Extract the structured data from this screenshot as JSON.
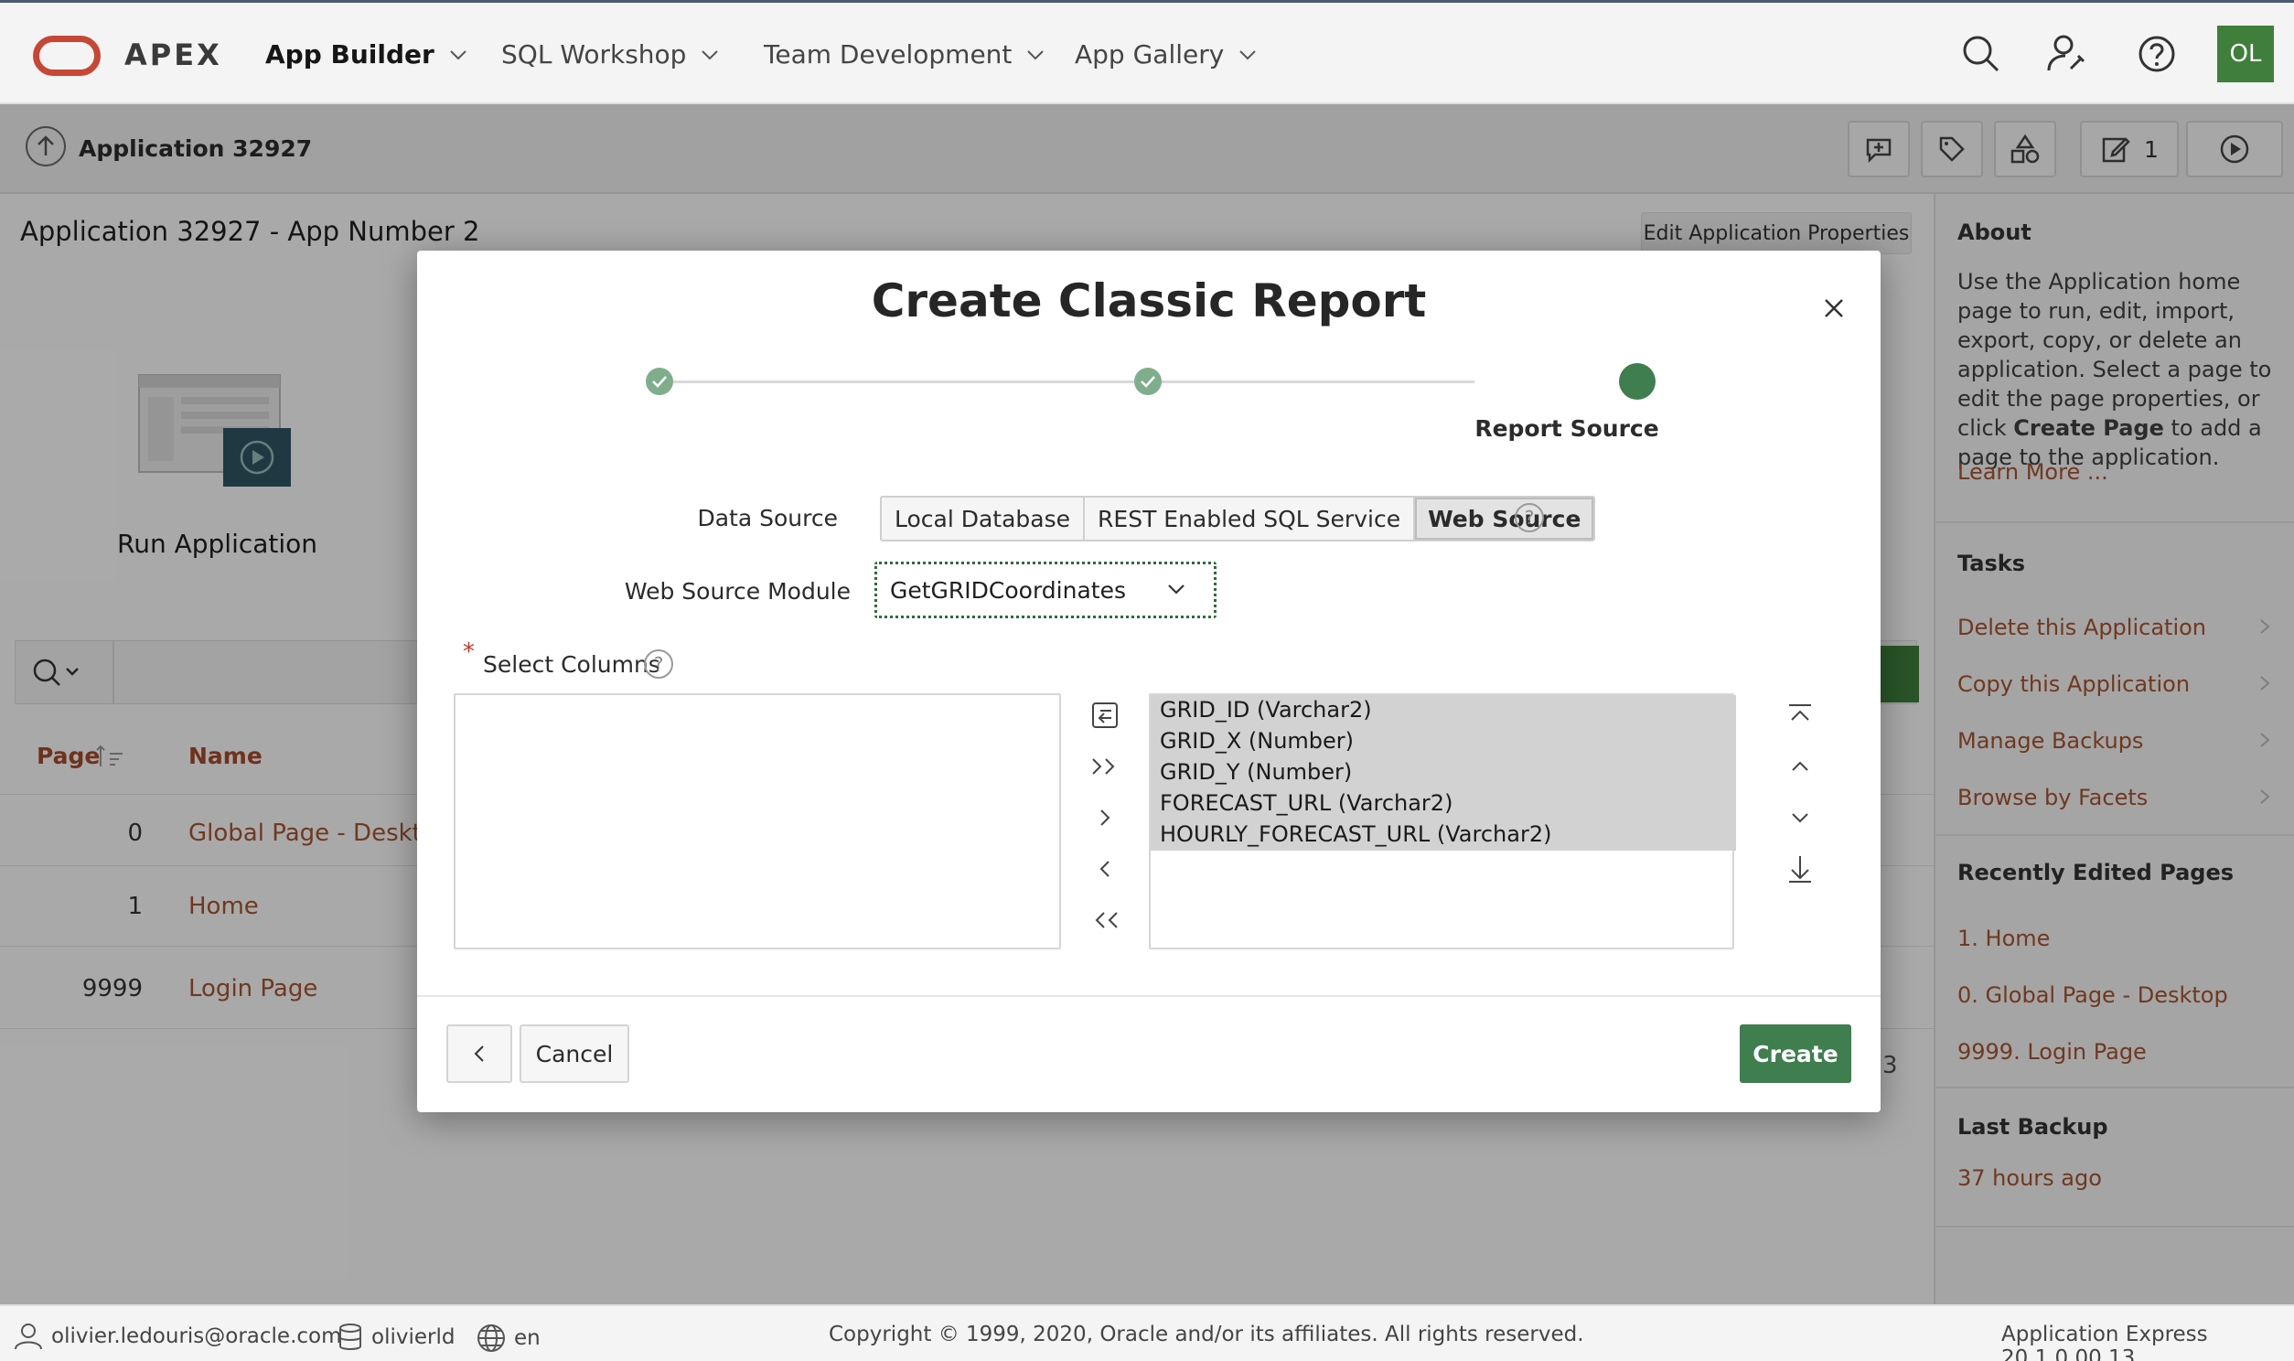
{
  "topnav": {
    "brand": "APEX",
    "items": [
      {
        "label": "App Builder",
        "active": true
      },
      {
        "label": "SQL Workshop",
        "active": false
      },
      {
        "label": "Team Development",
        "active": false
      },
      {
        "label": "App Gallery",
        "active": false
      }
    ],
    "icons": [
      "search-icon",
      "admin-user-icon",
      "help-icon"
    ],
    "avatar": "OL"
  },
  "subnav": {
    "breadcrumb": "Application 32927",
    "edit_count": "1",
    "icons": [
      "feedback-icon",
      "tag-icon",
      "shared-components-icon",
      "edit-icon",
      "run-icon"
    ]
  },
  "main": {
    "heading": "Application 32927 - App Number 2",
    "edit_properties": "Edit Application Properties",
    "run_application": "Run Application",
    "table": {
      "headers": {
        "page": "Page",
        "name": "Name"
      },
      "rows": [
        {
          "page": "0",
          "name": "Global Page - Desktop"
        },
        {
          "page": "1",
          "name": "Home"
        },
        {
          "page": "9999",
          "name": "Login Page"
        }
      ],
      "partial_count": "3"
    }
  },
  "sidebar": {
    "about_title": "About",
    "about_text_pre": "Use the Application home page to run, edit, import, export, copy, or delete an application. Select a page to edit the page properties, or click ",
    "about_text_bold": "Create Page",
    "about_text_post": " to add a page to the application.",
    "learn_more": "Learn More ...",
    "tasks_title": "Tasks",
    "tasks": [
      "Delete this Application",
      "Copy this Application",
      "Manage Backups",
      "Browse by Facets"
    ],
    "recent_title": "Recently Edited Pages",
    "recent": [
      "1. Home",
      "0. Global Page - Desktop",
      "9999. Login Page"
    ],
    "backup_title": "Last Backup",
    "backup_value": "37 hours ago"
  },
  "dialog": {
    "title": "Create Classic Report",
    "wizard": {
      "steps_total": 3,
      "current_step": 3,
      "current_label": "Report Source"
    },
    "data_source": {
      "label": "Data Source",
      "options": [
        "Local Database",
        "REST Enabled SQL Service",
        "Web Source"
      ],
      "selected": "Web Source"
    },
    "web_source_module": {
      "label": "Web Source Module",
      "value": "GetGRIDCoordinates"
    },
    "select_columns": {
      "label": "Select Columns",
      "required_mark": "*",
      "available": [],
      "selected": [
        "GRID_ID (Varchar2)",
        "GRID_X (Number)",
        "GRID_Y (Number)",
        "FORECAST_URL (Varchar2)",
        "HOURLY_FORECAST_URL (Varchar2)"
      ]
    },
    "buttons": {
      "cancel": "Cancel",
      "create": "Create"
    }
  },
  "footer": {
    "user": "olivier.ledouris@oracle.com",
    "workspace": "olivierld",
    "language": "en",
    "copyright": "Copyright © 1999, 2020, Oracle and/or its affiliates. All rights reserved.",
    "version": "Application Express 20.1.0.00.13"
  },
  "colors": {
    "brand_red": "#c74634",
    "accent_green": "#3f7e4f",
    "link": "#a5532f"
  }
}
